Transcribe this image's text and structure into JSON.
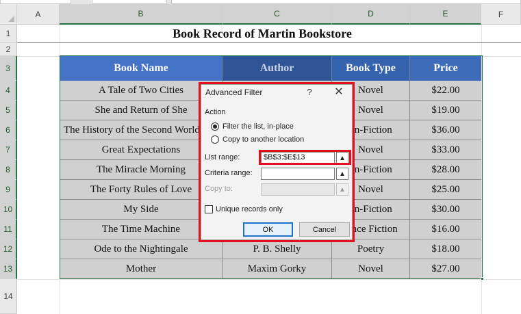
{
  "spreadsheet": {
    "columns": [
      "A",
      "B",
      "C",
      "D",
      "E",
      "F"
    ],
    "rows": [
      "1",
      "2",
      "3",
      "4",
      "5",
      "6",
      "7",
      "8",
      "9",
      "10",
      "11",
      "12",
      "13",
      "14"
    ],
    "title": "Book Record of Martin Bookstore",
    "headers": [
      "Book Name",
      "Author",
      "Book Type",
      "Price"
    ],
    "data": [
      [
        "A Tale of Two Cities",
        "",
        "Novel",
        "$22.00"
      ],
      [
        "She and Return of She",
        "",
        "Novel",
        "$19.00"
      ],
      [
        "The History of the Second World",
        "",
        "on-Fiction",
        "$36.00"
      ],
      [
        "Great Expectations",
        "",
        "Novel",
        "$33.00"
      ],
      [
        "The Miracle Morning",
        "",
        "on-Fiction",
        "$28.00"
      ],
      [
        "The Forty Rules of Love",
        "",
        "Novel",
        "$25.00"
      ],
      [
        "My Side",
        "",
        "on-Fiction",
        "$30.00"
      ],
      [
        "The Time Machine",
        "",
        "ence Fiction",
        "$16.00"
      ],
      [
        "Ode to the Nightingale",
        "P. B. Shelly",
        "Poetry",
        "$18.00"
      ],
      [
        "Mother",
        "Maxim Gorky",
        "Novel",
        "$27.00"
      ]
    ]
  },
  "dialog": {
    "title": "Advanced Filter",
    "help": "?",
    "close": "✕",
    "action_label": "Action",
    "option_filter_in_place": "Filter the list, in-place",
    "option_copy_to_location": "Copy to another location",
    "list_range_label": "List range:",
    "list_range_value": "$B$3:$E$13",
    "criteria_range_label": "Criteria range:",
    "criteria_range_value": "",
    "copy_to_label": "Copy to:",
    "copy_to_value": "",
    "unique_records_label": "Unique records only",
    "ok": "OK",
    "cancel": "Cancel",
    "selected_option": "filter_in_place",
    "unique_records_checked": false
  },
  "colors": {
    "header_blue": "#4472c4",
    "header_blue_dark": "#2f5597",
    "cell_gray": "#d0d0d0",
    "highlight_red": "#e0101e",
    "excel_green": "#217346"
  }
}
